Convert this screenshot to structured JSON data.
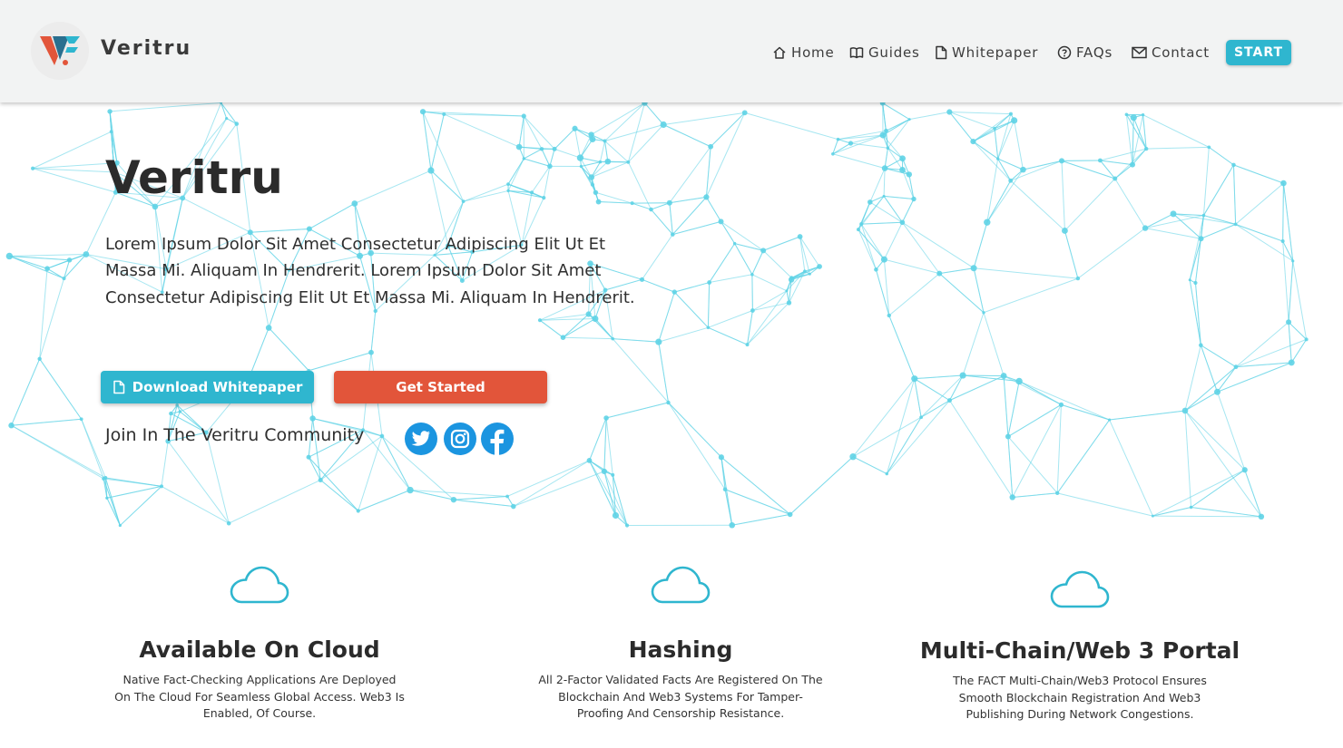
{
  "brand": {
    "name": "Veritru"
  },
  "nav": {
    "items": [
      {
        "label": "Home",
        "icon": "home-icon"
      },
      {
        "label": "Guides",
        "icon": "book-icon"
      },
      {
        "label": "Whitepaper",
        "icon": "document-icon"
      },
      {
        "label": "FAQs",
        "icon": "question-circle-icon"
      },
      {
        "label": "Contact",
        "icon": "mail-icon"
      }
    ],
    "start_label": "START"
  },
  "hero": {
    "title": "Veritru",
    "description": "Lorem Ipsum Dolor Sit Amet Consectetur Adipiscing Elit Ut Et Massa Mi. Aliquam In Hendrerit. Lorem Ipsum Dolor Sit Amet Consectetur Adipiscing Elit Ut Et Massa Mi. Aliquam In Hendrerit.",
    "download_label": "Download Whitepaper",
    "get_started_label": "Get Started",
    "community_label": "Join In The Veritru Community",
    "social": [
      "twitter-icon",
      "instagram-icon",
      "facebook-icon"
    ]
  },
  "features": [
    {
      "icon": "cloud-icon",
      "title": "Available On Cloud",
      "text": "Native Fact-Checking Applications Are Deployed On The Cloud For Seamless Global Access. Web3 Is Enabled, Of Course."
    },
    {
      "icon": "cloud-icon",
      "title": "Hashing",
      "text": "All 2-Factor Validated Facts Are Registered On The Blockchain And Web3 Systems For Tamper-Proofing And Censorship Resistance."
    },
    {
      "icon": "cloud-icon",
      "title": "Multi-Chain/Web 3 Portal",
      "text": "The FACT Multi-Chain/Web3 Protocol Ensures Smooth Blockchain Registration And Web3 Publishing During Network Congestions."
    }
  ],
  "colors": {
    "accent": "#2fb6cf",
    "cta": "#e2553a",
    "network": "#5fd3e6",
    "header_bg": "#f2f3f3",
    "social": "#1b95e0"
  }
}
